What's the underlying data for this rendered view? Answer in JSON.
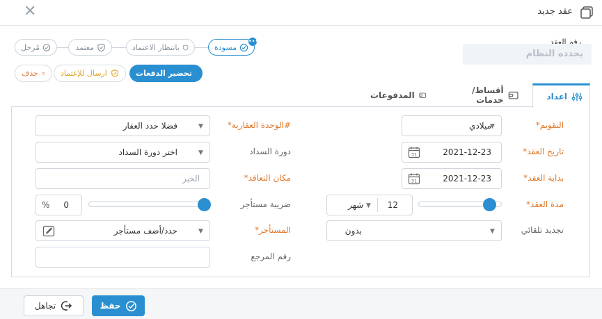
{
  "window": {
    "title": "عقد جديد"
  },
  "contract_number": {
    "label": "رقم العقد",
    "value": "يحدده النظام"
  },
  "status_steps": [
    {
      "label": "مسودة",
      "active": true
    },
    {
      "label": "بانتظار الاعتماد",
      "active": false
    },
    {
      "label": "معتمد",
      "active": false
    },
    {
      "label": "مُرحل",
      "active": false
    }
  ],
  "actions": {
    "prepare_payments": "تحضير الدفعات",
    "send_for_approval": "ارسال للإعتماد",
    "delete": "حذف"
  },
  "tabs": [
    {
      "label": "اعداد",
      "active": true
    },
    {
      "label": "أقساط/خدمات",
      "active": false
    },
    {
      "label": "المدفوعات",
      "active": false
    }
  ],
  "form": {
    "calendar": {
      "label": "التقويم*",
      "value": "ميلادي"
    },
    "contract_date": {
      "label": "تاريخ العقد*",
      "value": "2021-12-23"
    },
    "contract_start": {
      "label": "بداية العقد*",
      "value": "2021-12-23"
    },
    "contract_duration": {
      "label": "مدة العقد*",
      "value": "12",
      "unit": "شهر",
      "slider_fraction": 0.85
    },
    "auto_renew": {
      "label": "تجديد تلقائي",
      "value": "بدون"
    },
    "property_unit": {
      "label": "#الوحدة العقارية*",
      "value": "فضلا حدد العقار"
    },
    "payment_cycle": {
      "label": "دورة السداد",
      "value": "اختر دورة السداد"
    },
    "contract_place": {
      "label": "مكان التعاقد*",
      "placeholder": "الخبر"
    },
    "tenant_tax": {
      "label": "ضريبة مستأجر",
      "value": "0",
      "unit": "%",
      "slider_fraction": 0.95
    },
    "tenant": {
      "label": "المستأجر*",
      "value": "حدد/أضف مستأجر"
    },
    "reference_number": {
      "label": "رقم المرجع",
      "value": ""
    }
  },
  "footer": {
    "save": "حفظ",
    "ignore": "تجاهل"
  },
  "colors": {
    "accent": "#2a8fd0",
    "required_label": "#e07a2d",
    "warning": "#e0a423",
    "danger": "#e27a4a"
  },
  "icons": {
    "window": "window-icon",
    "close": "close-icon",
    "draft": "check-circle-icon",
    "pending": "shield-icon",
    "approved": "shield-check-icon",
    "posted": "check-circle-icon",
    "wallet": "wallet-icon",
    "trash": "trash-icon",
    "settings": "sliders-icon",
    "calendar": "calendar-icon",
    "edit": "edit-icon",
    "save": "check-circle-icon",
    "ignore": "exit-icon"
  }
}
